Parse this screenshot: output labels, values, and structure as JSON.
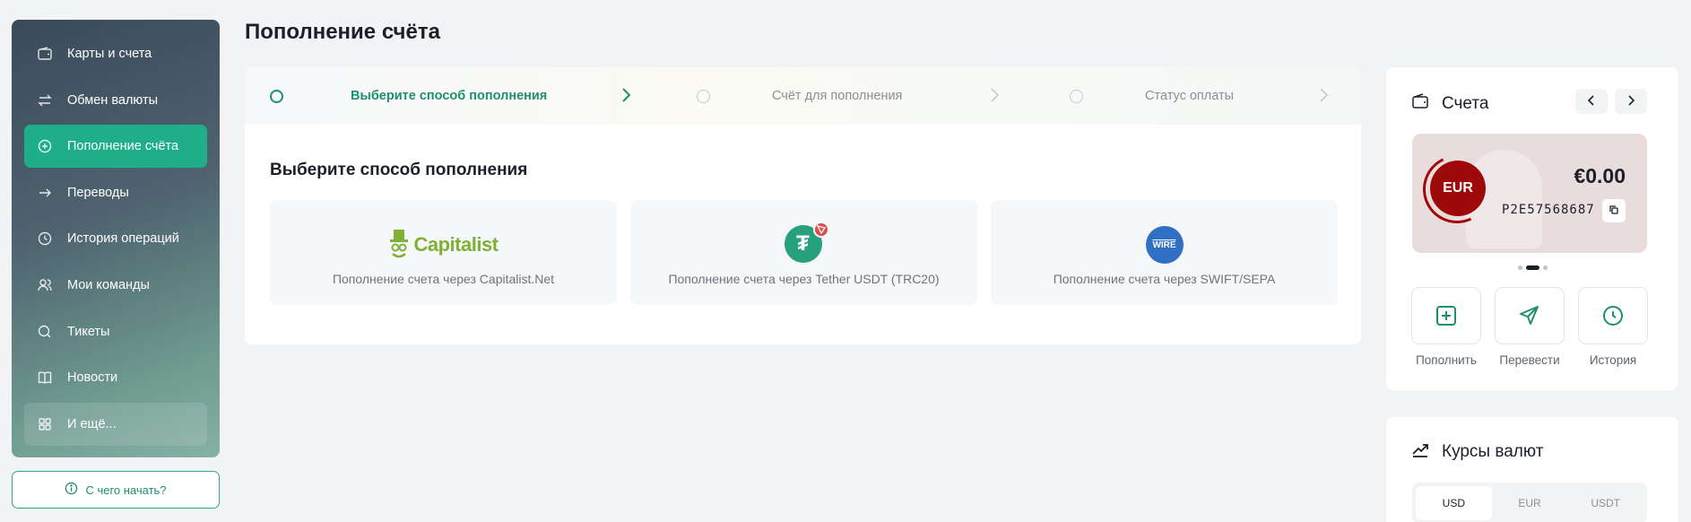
{
  "sidebar": {
    "items": [
      {
        "label": "Карты и счета",
        "icon": "wallet-icon"
      },
      {
        "label": "Обмен валюты",
        "icon": "exchange-icon"
      },
      {
        "label": "Пополнение счёта",
        "icon": "plus-circle-icon",
        "active": true
      },
      {
        "label": "Переводы",
        "icon": "arrow-right-icon"
      },
      {
        "label": "История операций",
        "icon": "clock-icon"
      },
      {
        "label": "Мои команды",
        "icon": "users-icon"
      },
      {
        "label": "Тикеты",
        "icon": "chat-icon"
      },
      {
        "label": "Новости",
        "icon": "book-icon"
      },
      {
        "label": "И ещё...",
        "icon": "grid-icon"
      }
    ],
    "help_label": "С чего начать?"
  },
  "page": {
    "title": "Пополнение счёта",
    "steps": [
      {
        "label": "Выберите способ пополнения",
        "active": true
      },
      {
        "label": "Счёт для пополнения",
        "active": false
      },
      {
        "label": "Статус оплаты",
        "active": false
      }
    ],
    "section_title": "Выберите способ пополнения",
    "methods": [
      {
        "label": "Пополнение счета через Capitalist.Net",
        "logo_text": "Capitalist"
      },
      {
        "label": "Пополнение счета через Tether USDT (TRC20)",
        "logo_text": "₮"
      },
      {
        "label": "Пополнение счета через SWIFT/SEPA",
        "logo_text": "WIRE"
      }
    ]
  },
  "accounts": {
    "title": "Счета",
    "currency": "EUR",
    "balance": "€0.00",
    "account_number": "P2E57568687",
    "actions": [
      {
        "label": "Пополнить",
        "icon": "plus-square-icon"
      },
      {
        "label": "Перевести",
        "icon": "send-icon"
      },
      {
        "label": "История",
        "icon": "clock-icon"
      }
    ]
  },
  "rates": {
    "title": "Курсы валют",
    "tabs": [
      "USD",
      "EUR",
      "USDT"
    ]
  },
  "colors": {
    "accent": "#1fae8a",
    "eur_badge": "#9e0a0a"
  }
}
